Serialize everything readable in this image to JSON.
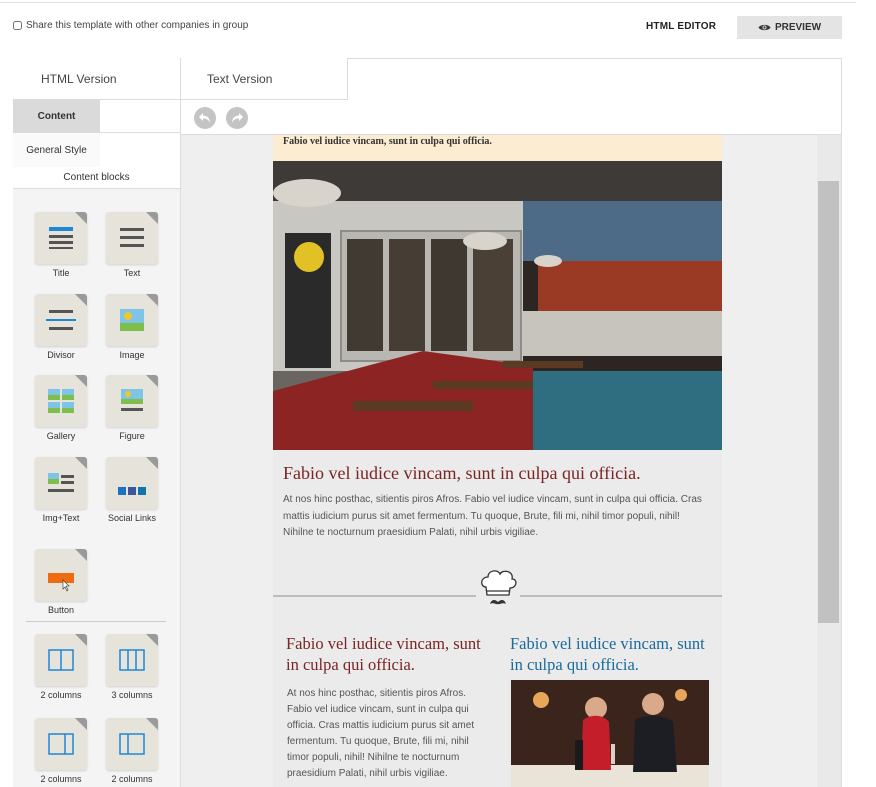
{
  "header": {
    "share_label": "Share this template with other companies in group",
    "html_editor_label": "HTML EDITOR",
    "preview_label": "PREVIEW"
  },
  "version_tabs": [
    "HTML Version",
    "Text Version"
  ],
  "sidebar": {
    "content_tab": "Content",
    "general_style_tab": "General Style",
    "content_blocks_label": "Content blocks",
    "blocks": [
      {
        "label": "Title",
        "icon": "title-block-icon"
      },
      {
        "label": "Text",
        "icon": "text-block-icon"
      },
      {
        "label": "Divisor",
        "icon": "divisor-block-icon"
      },
      {
        "label": "Image",
        "icon": "image-block-icon"
      },
      {
        "label": "Gallery",
        "icon": "gallery-block-icon"
      },
      {
        "label": "Figure",
        "icon": "figure-block-icon"
      },
      {
        "label": "Img+Text",
        "icon": "img-text-block-icon"
      },
      {
        "label": "Social Links",
        "icon": "social-links-block-icon"
      },
      {
        "label": "Button",
        "icon": "button-block-icon"
      },
      {
        "label": "2 columns",
        "icon": "two-columns-block-icon"
      },
      {
        "label": "3 columns",
        "icon": "three-columns-block-icon"
      },
      {
        "label": "2 columns",
        "icon": "two-columns-alt-block-icon"
      },
      {
        "label": "2 columns",
        "icon": "two-columns-alt2-block-icon"
      }
    ]
  },
  "toolbar": {
    "undo_icon": "undo-icon",
    "redo_icon": "redo-icon"
  },
  "email": {
    "top_strip_text": "Fabio vel iudice vincam, sunt in culpa qui officia.",
    "heading1": "Fabio vel iudice vincam, sunt in culpa qui officia.",
    "paragraph1": "At nos hinc posthac, sitientis piros Afros. Fabio vel iudice vincam, sunt in culpa qui officia. Cras mattis iudicium purus sit amet fermentum. Tu quoque, Brute, fili mi, nihil timor populi, nihil! Nihilne te nocturnum praesidium Palati, nihil urbis vigiliae.",
    "col1_heading": "Fabio vel iudice vincam, sunt in culpa qui officia.",
    "col2_heading": "Fabio vel iudice vincam, sunt in culpa qui officia.",
    "col1_paragraph": "At nos hinc posthac, sitientis piros Afros. Fabio vel iudice vincam, sunt in culpa qui officia. Cras mattis iudicium purus sit amet fermentum. Tu quoque, Brute, fili mi, nihil timor populi, nihil! Nihilne te nocturnum praesidium Palati, nihil urbis vigiliae.",
    "colors": {
      "heading_red": "#7a2424",
      "heading_blue": "#1a6a9a",
      "strip": "#fcecd2"
    }
  }
}
